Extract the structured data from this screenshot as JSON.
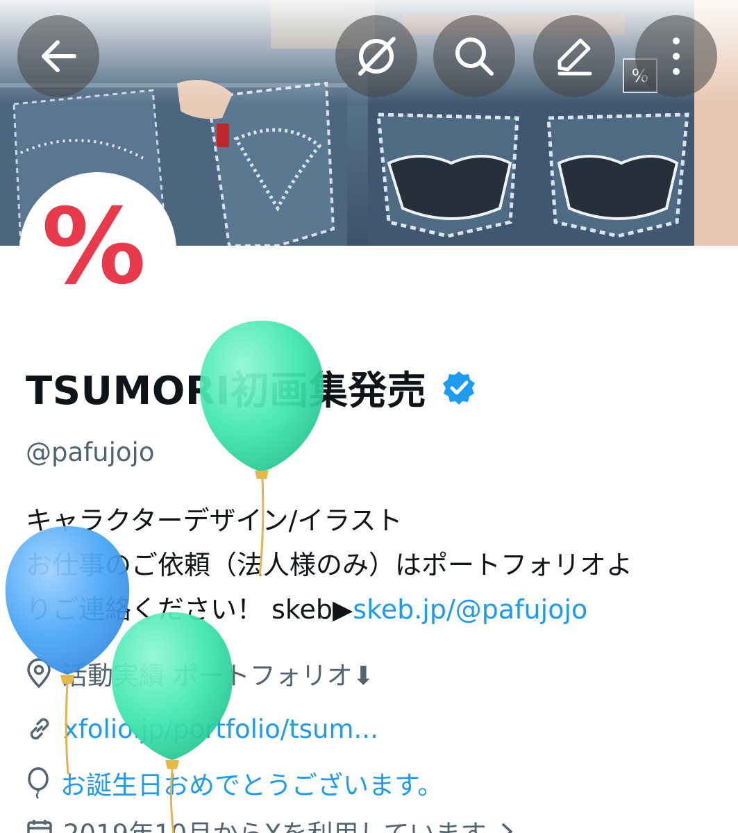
{
  "header": {
    "back_icon": "arrow-left-icon",
    "grok_icon": "grok-icon",
    "search_icon": "search-icon",
    "edit_icon": "pencil-icon",
    "more_icon": "more-vertical-icon",
    "banner_mark": "%"
  },
  "profile": {
    "avatar_glyph": "%",
    "avatar_color": "#e83a4a",
    "display_name": "TSUMORI初画集発売",
    "verified": true,
    "verified_color": "#1d9bf0",
    "handle": "@pafujojo"
  },
  "bio": {
    "line1": "キャラクターデザイン/イラスト",
    "line2": "お仕事のご依頼（法人様のみ）はポートフォリオよ",
    "line3_text": "りご連絡ください！ skeb▶",
    "line3_link": "skeb.jp/@pafujojo"
  },
  "meta": {
    "location_icon": "location-pin-icon",
    "location": "活動実績 ポートフォリオ⬇",
    "website_icon": "link-icon",
    "website": "xfolio.jp/portfolio/tsum...",
    "birthday_icon": "balloon-icon",
    "birthday": "お誕生日おめでとうございます。",
    "joined_icon": "calendar-icon",
    "joined": "2019年10月からXを利用しています",
    "joined_chevron": "chevron-right-icon"
  },
  "colors": {
    "link": "#1d9bf0",
    "secondary_text": "#536471",
    "primary_text": "#0f1419",
    "balloon_green": "#3ee6b0",
    "balloon_blue": "#3f9df5"
  }
}
